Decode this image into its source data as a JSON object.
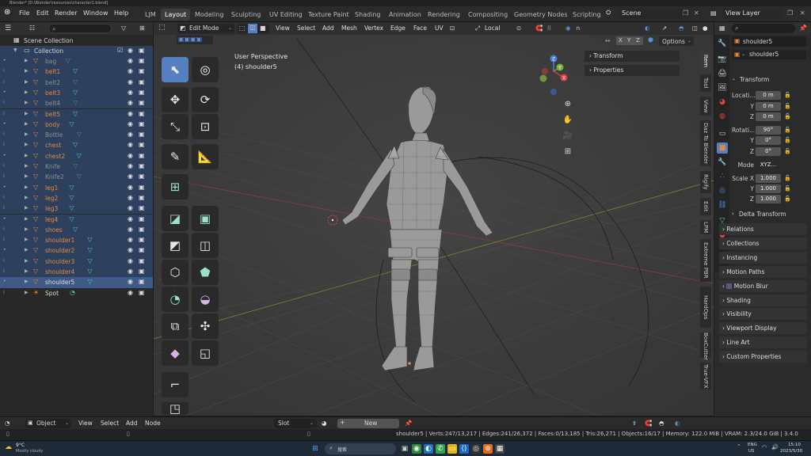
{
  "titlebar": {
    "text": "Blender* [D:\\Blender\\resources\\character1.blend]"
  },
  "menu": {
    "file": "File",
    "edit": "Edit",
    "render": "Render",
    "window": "Window",
    "help": "Help"
  },
  "workspaces": [
    "LJM",
    "Layout",
    "Modeling",
    "Sculpting",
    "UV Editing",
    "Texture Paint",
    "Shading",
    "Animation",
    "Rendering",
    "Compositing",
    "Geometry Nodes",
    "Scripting"
  ],
  "scene": {
    "name": "Scene",
    "view_layer": "View Layer"
  },
  "outliner": {
    "scene_collection": "Scene Collection",
    "collection": "Collection",
    "items": [
      {
        "name": "bag",
        "style": "grey",
        "mod": true
      },
      {
        "name": "belt1",
        "style": "orange",
        "mod": true
      },
      {
        "name": "belt2",
        "style": "grey",
        "mod": true
      },
      {
        "name": "belt3",
        "style": "orange",
        "mod": true
      },
      {
        "name": "belt4",
        "style": "grey",
        "mod": true
      },
      {
        "name": "belt5",
        "style": "orange",
        "mod": true
      },
      {
        "name": "body",
        "style": "orange",
        "mod": true
      },
      {
        "name": "Bottle",
        "style": "grey",
        "mod": true
      },
      {
        "name": "chest",
        "style": "orange",
        "mod": true
      },
      {
        "name": "chest2",
        "style": "orange",
        "mod": true
      },
      {
        "name": "Knife",
        "style": "grey",
        "mod": true
      },
      {
        "name": "Knife2",
        "style": "grey",
        "mod": true
      },
      {
        "name": "leg1",
        "style": "orange",
        "mod": true
      },
      {
        "name": "leg2",
        "style": "orange",
        "mod": true
      },
      {
        "name": "leg3",
        "style": "orange",
        "mod": true
      },
      {
        "name": "leg4",
        "style": "orange",
        "mod": true
      },
      {
        "name": "shoes",
        "style": "orange",
        "mod": true
      },
      {
        "name": "shoulder1",
        "style": "orange",
        "mod": true
      },
      {
        "name": "shoulder2",
        "style": "orange",
        "mod": true
      },
      {
        "name": "shoulder3",
        "style": "orange",
        "mod": true
      },
      {
        "name": "shoulder4",
        "style": "orange",
        "mod": true
      },
      {
        "name": "shoulder5",
        "style": "white",
        "mod": true,
        "active": true
      },
      {
        "name": "Spot",
        "style": "white",
        "mod": false
      }
    ]
  },
  "viewport": {
    "mode": "Edit Mode",
    "menus": [
      "View",
      "Select",
      "Add",
      "Mesh",
      "Vertex",
      "Edge",
      "Face",
      "UV"
    ],
    "orientation": "Local",
    "options": "Options",
    "axes": [
      "X",
      "Y",
      "Z"
    ],
    "perspective": "User Perspective",
    "object": "(4) shoulder5",
    "npanel": {
      "transform": "Transform",
      "properties": "Properties"
    },
    "side_tabs": [
      "Item",
      "Tool",
      "View",
      "Daz To Blender",
      "Rigify",
      "Edit",
      "LPM",
      "Extreme PBR",
      "HardOps",
      "BoxCutter",
      "True-VFX"
    ]
  },
  "properties": {
    "object_name": "shoulder5",
    "transform": "Transform",
    "location_label": "Locati...",
    "location": [
      "0 m",
      "0 m",
      "0 m"
    ],
    "rotation_label": "Rotati...",
    "rotation": [
      "90°",
      "0°",
      "0°"
    ],
    "mode_label": "Mode",
    "mode_value": "XYZ...",
    "scale_label": "Scale X",
    "scale": [
      "1.000",
      "1.000",
      "1.000"
    ],
    "axis_y": "Y",
    "axis_z": "Z",
    "delta": "Delta Transform",
    "sections": [
      "Relations",
      "Collections",
      "Instancing",
      "Motion Paths",
      "Motion Blur",
      "Shading",
      "Visibility",
      "Viewport Display",
      "Line Art",
      "Custom Properties"
    ]
  },
  "timeline": {
    "object": "Object",
    "view": "View",
    "select": "Select",
    "add": "Add",
    "node": "Node",
    "slot": "Slot",
    "new": "New"
  },
  "status": {
    "text": "shoulder5 | Verts:247/13,217 | Edges:241/26,372 | Faces:0/13,185 | Tris:26,271 | Objects:16/17 | Memory: 122.0 MiB | VRAM: 2.3/24.0 GiB | 3.4.0"
  },
  "taskbar": {
    "weather_temp": "9°C",
    "weather_desc": "Mostly cloudy",
    "search": "搜索",
    "lang1": "ENG",
    "lang2": "US",
    "time": "15:10",
    "date": "2023/5/30"
  },
  "colors": {
    "accent": "#5680c2",
    "selected_row": "#2d405d",
    "active_row": "#3f5a86",
    "orange": "#e2893f",
    "modifier": "#4fc7b5"
  }
}
